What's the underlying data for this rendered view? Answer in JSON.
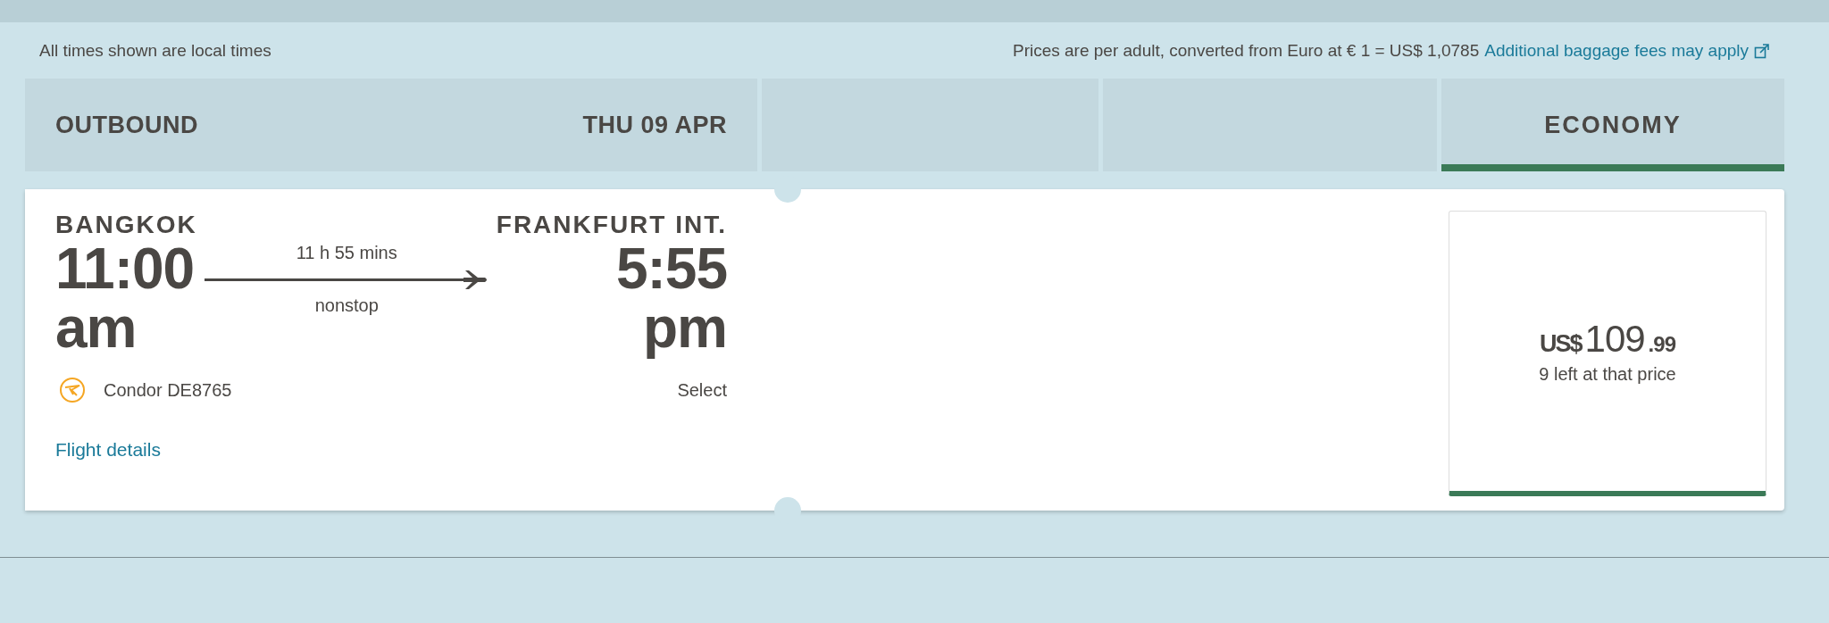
{
  "notes": {
    "local_times": "All times shown are local times",
    "prices": "Prices are per adult, converted from Euro at € 1 = US$ 1,0785",
    "baggage_link": "Additional baggage fees may apply"
  },
  "header": {
    "direction": "OUTBOUND",
    "date": "THU 09 APR",
    "fare_class": {
      "label": "ECONOMY",
      "selected": true
    }
  },
  "flight": {
    "origin": "BANGKOK",
    "departure_time": "11:00",
    "departure_period": "am",
    "duration": "11 h 55 mins",
    "stops": "nonstop",
    "destination": "FRANKFURT INT.",
    "arrival_time": "5:55",
    "arrival_period": "pm",
    "airline": "Condor DE8765",
    "select": "Select",
    "details_link": "Flight details"
  },
  "fare": {
    "currency": "US$",
    "amount": "109",
    "cents": ".99",
    "availability": "9 left at that price",
    "selected": true
  }
}
